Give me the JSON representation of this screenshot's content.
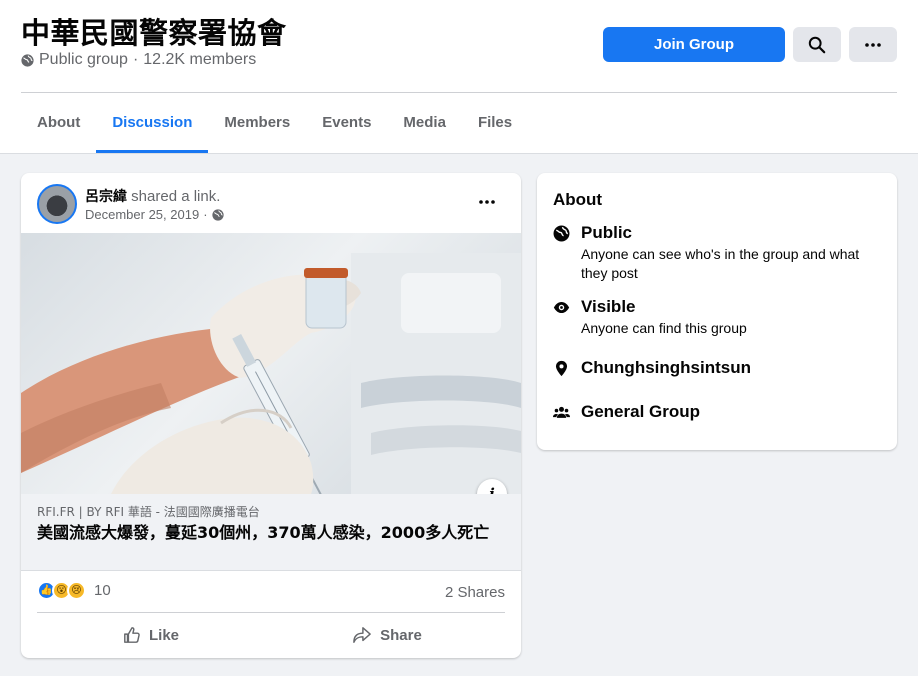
{
  "group": {
    "name": "中華民國警察署協會",
    "privacy": "Public group",
    "members": "12.2K members"
  },
  "header": {
    "join_label": "Join Group"
  },
  "tabs": [
    {
      "label": "About"
    },
    {
      "label": "Discussion"
    },
    {
      "label": "Members"
    },
    {
      "label": "Events"
    },
    {
      "label": "Media"
    },
    {
      "label": "Files"
    }
  ],
  "active_tab": "Discussion",
  "post": {
    "author": "呂宗緯",
    "action": "shared a link.",
    "date": "December 25, 2019",
    "link_source": "RFI.FR | BY RFI 華語 - 法國國際廣播電台",
    "link_title": "美國流感大爆發，蔓延30個州，370萬人感染，2000多人死亡",
    "reaction_count": "10",
    "shares": "2 Shares",
    "like_label": "Like",
    "share_label": "Share"
  },
  "about": {
    "title": "About",
    "items": [
      {
        "icon": "globe-icon",
        "title": "Public",
        "desc": "Anyone can see who's in the group and what they post"
      },
      {
        "icon": "eye-icon",
        "title": "Visible",
        "desc": "Anyone can find this group"
      },
      {
        "icon": "location-pin-icon",
        "title": "Chunghsinghsintsun",
        "desc": ""
      },
      {
        "icon": "people-icon",
        "title": "General Group",
        "desc": ""
      }
    ]
  },
  "colors": {
    "accent": "#1877f2",
    "background": "#f0f2f5",
    "secondary_text": "#65676b"
  }
}
